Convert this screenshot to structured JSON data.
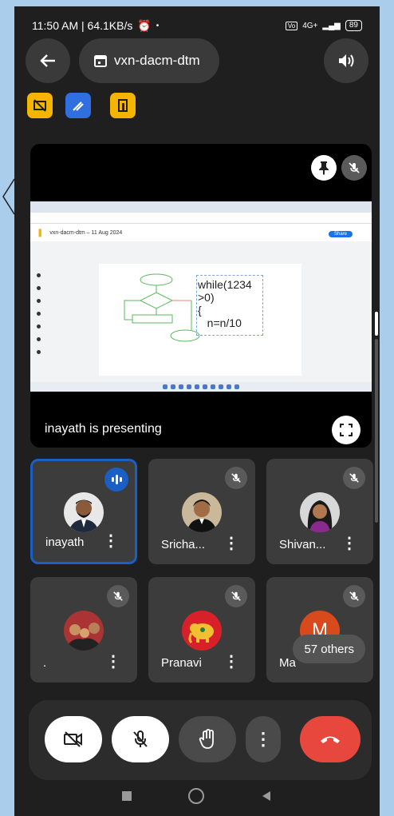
{
  "status_bar": {
    "time_speed": "11:50 AM | 64.1KB/s",
    "battery": "89",
    "network": "4G+"
  },
  "meeting": {
    "code": "vxn-dacm-dtm"
  },
  "presentation": {
    "label": "inayath is presenting",
    "doc_title": "vxn-dacm-dtm – 11 Aug 2024",
    "share_label": "Share",
    "code_text": "while(1234\n>0)\n{\n   n=n/10"
  },
  "participants": [
    {
      "name": "inayath",
      "speaking": true
    },
    {
      "name": "Sricha...",
      "speaking": false
    },
    {
      "name": "Shivan...",
      "speaking": false
    },
    {
      "name": ".",
      "speaking": false
    },
    {
      "name": "Pranavi",
      "speaking": false
    },
    {
      "name": "Ma",
      "speaking": false,
      "initial": "M"
    }
  ],
  "others_label": "57 others",
  "colors": {
    "speaking_blue": "#1a5fc4",
    "end_call_red": "#e8473d",
    "chip_yellow": "#f5b400",
    "chip_blue": "#2f6fe0"
  }
}
